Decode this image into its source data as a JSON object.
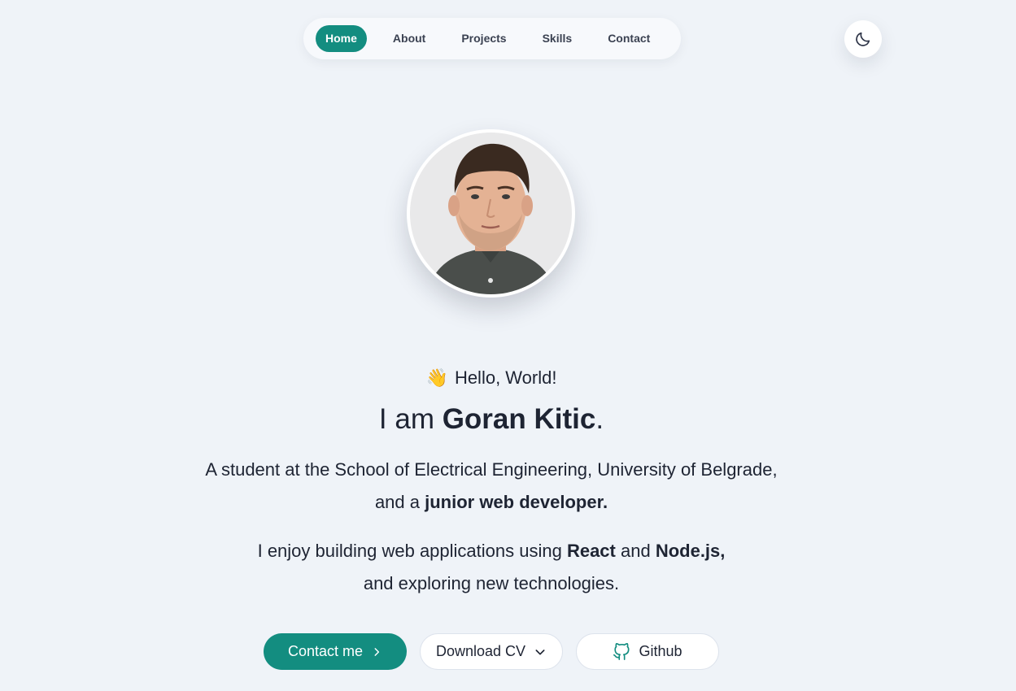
{
  "nav": {
    "items": [
      {
        "label": "Home",
        "active": true
      },
      {
        "label": "About"
      },
      {
        "label": "Projects"
      },
      {
        "label": "Skills"
      },
      {
        "label": "Contact"
      }
    ]
  },
  "theme_toggle": {
    "icon": "moon-icon"
  },
  "hero": {
    "greeting_emoji": "👋",
    "greeting": "Hello, World!",
    "title_prefix": "I am ",
    "name": "Goran Kitic",
    "title_suffix": ".",
    "line1": "A student at the School of Electrical Engineering, University of Belgrade,",
    "line2_prefix": "and a ",
    "line2_bold": "junior web developer.",
    "line3_prefix": "I enjoy building web applications using ",
    "line3_bold1": "React",
    "line3_mid": " and ",
    "line3_bold2": "Node.js,",
    "line4": "and exploring new technologies."
  },
  "buttons": {
    "contact": "Contact me",
    "cv": "Download CV",
    "github": "Github"
  },
  "colors": {
    "accent": "#138d80",
    "background": "#eff3f8"
  }
}
